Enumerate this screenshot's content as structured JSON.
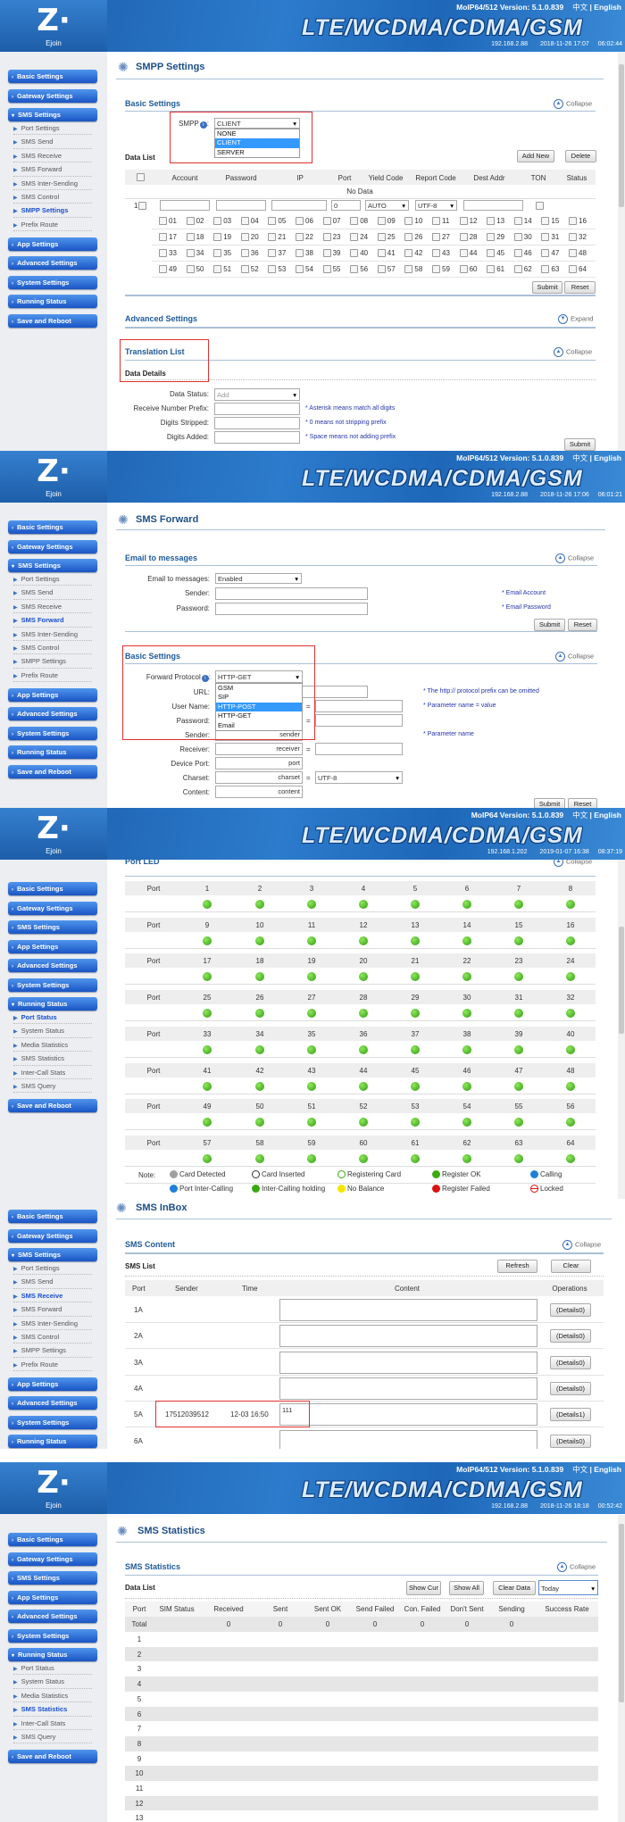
{
  "brand": {
    "logo": "Z·",
    "name": "Ejoin",
    "banner": "LTE/WCDMA/CDMA/GSM",
    "lang_zh": "中文",
    "lang_sep": "|",
    "lang_en": "English"
  },
  "colors": {
    "accent": "#1a55c4",
    "highlight": "#3399ff",
    "red_box": "#e03030",
    "led_ok": "#2f9a10"
  },
  "panels": [
    {
      "header": {
        "version": "MoIP64/512 Version: 5.1.0.839",
        "ip": "192.168.2.88",
        "datetime": "2018-11-26 17:07",
        "uptime": "06:02:44"
      },
      "sidebar": [
        {
          "label": "Basic Settings",
          "group": true
        },
        {
          "label": "Gateway Settings",
          "group": true
        },
        {
          "label": "SMS Settings",
          "group": true,
          "expanded": true,
          "items": [
            {
              "label": "Port Settings"
            },
            {
              "label": "SMS Send"
            },
            {
              "label": "SMS Receive"
            },
            {
              "label": "SMS Forward"
            },
            {
              "label": "SMS Inter-Sending"
            },
            {
              "label": "SMS Control"
            },
            {
              "label": "SMPP Settings",
              "active": true
            },
            {
              "label": "Prefix Route"
            }
          ]
        },
        {
          "label": "App Settings",
          "group": true
        },
        {
          "label": "Advanced Settings",
          "group": true
        },
        {
          "label": "System Settings",
          "group": true
        },
        {
          "label": "Running Status",
          "group": true
        },
        {
          "label": "Save and Reboot",
          "group": true
        }
      ],
      "title": "SMPP Settings",
      "basic": {
        "heading": "Basic Settings",
        "collapse": "Collapse",
        "smpp_label": "SMPP",
        "smpp_value": "CLIENT",
        "smpp_options": [
          "NONE",
          "CLIENT",
          "SERVER"
        ],
        "smpp_selected": "CLIENT"
      },
      "data_list": {
        "label": "Data List",
        "add_new": "Add New",
        "delete": "Delete",
        "columns": [
          "Account",
          "Password",
          "IP",
          "Port",
          "Yield Code",
          "Report Code",
          "Dest Addr",
          "TON",
          "Status"
        ],
        "no_data": "No Data",
        "new_row": {
          "index": "1",
          "port": "0",
          "yield": "AUTO",
          "report": "UTF-8"
        },
        "port_count": 64
      },
      "submit": "Submit",
      "reset": "Reset",
      "advanced": {
        "heading": "Advanced Settings",
        "expand": "Expand"
      },
      "translation": {
        "heading": "Translation List",
        "collapse": "Collapse",
        "details": "Data Details",
        "fields": [
          {
            "label": "Data Status:",
            "value": "Add",
            "type": "select",
            "hint": ""
          },
          {
            "label": "Receive Number Prefix:",
            "value": "",
            "type": "input",
            "hint": "* Asterisk means match all digits"
          },
          {
            "label": "Digits Stripped:",
            "value": "",
            "type": "input",
            "hint": "* 0 means not stripping prefix"
          },
          {
            "label": "Digits Added:",
            "value": "",
            "type": "input",
            "hint": "* Space means not adding prefix"
          }
        ],
        "submit": "Submit"
      }
    },
    {
      "header": {
        "version": "MoIP64/512 Version: 5.1.0.839",
        "ip": "192.168.2.88",
        "datetime": "2018-11-26 17:06",
        "uptime": "06:01:21"
      },
      "sidebar": [
        {
          "label": "Basic Settings",
          "group": true
        },
        {
          "label": "Gateway Settings",
          "group": true
        },
        {
          "label": "SMS Settings",
          "group": true,
          "expanded": true,
          "items": [
            {
              "label": "Port Settings"
            },
            {
              "label": "SMS Send"
            },
            {
              "label": "SMS Receive"
            },
            {
              "label": "SMS Forward",
              "active": true
            },
            {
              "label": "SMS Inter-Sending"
            },
            {
              "label": "SMS Control"
            },
            {
              "label": "SMPP Settings"
            },
            {
              "label": "Prefix Route"
            }
          ]
        },
        {
          "label": "App Settings",
          "group": true
        },
        {
          "label": "Advanced Settings",
          "group": true
        },
        {
          "label": "System Settings",
          "group": true
        },
        {
          "label": "Running Status",
          "group": true
        },
        {
          "label": "Save and Reboot",
          "group": true
        }
      ],
      "title": "SMS Forward",
      "email": {
        "heading": "Email to messages",
        "collapse": "Collapse",
        "mode_label": "Email to messages:",
        "mode_value": "Enabled",
        "sender_label": "Sender:",
        "password_label": "Password:",
        "sender_hint": "* Email Account",
        "password_hint": "* Email Password",
        "submit": "Submit",
        "reset": "Reset"
      },
      "basic": {
        "heading": "Basic Settings",
        "collapse": "Collapse",
        "protocol_label": "Forward Protocol",
        "protocol_value": "HTTP-GET",
        "protocol_options": [
          "GSM",
          "SIP",
          "HTTP-POST",
          "HTTP-GET",
          "Email"
        ],
        "protocol_highlight": "HTTP-POST",
        "url_label": "URL:",
        "url_hint": "* The http:// protocol prefix can be omitted",
        "user_label": "User Name:",
        "user_hint": "* Parameter name = value",
        "password_label": "Password:",
        "sender_label": "Sender:",
        "sender_value": "sender",
        "sender_hint": "* Parameter name",
        "receiver_label": "Receiver:",
        "receiver_value": "receiver",
        "port_label": "Device Port:",
        "port_value": "port",
        "charset_label": "Charset:",
        "charset_value": "charset",
        "charset_select": "UTF-8",
        "content_label": "Content:",
        "content_value": "content",
        "equals": "=",
        "submit": "Submit",
        "reset": "Reset"
      }
    },
    {
      "header": {
        "version": "MoIP64 Version: 5.1.0.839",
        "ip": "192.168.1.202",
        "datetime": "2019-01-07 16:38",
        "uptime": "08:37:19"
      },
      "sidebar": [
        {
          "label": "Basic Settings",
          "group": true
        },
        {
          "label": "Gateway Settings",
          "group": true
        },
        {
          "label": "SMS Settings",
          "group": true
        },
        {
          "label": "App Settings",
          "group": true
        },
        {
          "label": "Advanced Settings",
          "group": true
        },
        {
          "label": "System Settings",
          "group": true
        },
        {
          "label": "Running Status",
          "group": true,
          "expanded": true,
          "items": [
            {
              "label": "Port Status",
              "active": true
            },
            {
              "label": "System Status"
            },
            {
              "label": "Media Statistics"
            },
            {
              "label": "SMS Statistics"
            },
            {
              "label": "Inter-Call Stats"
            },
            {
              "label": "SMS Query"
            }
          ]
        },
        {
          "label": "Save and Reboot",
          "group": true
        }
      ],
      "section": {
        "heading": "Port LED",
        "collapse": "Collapse"
      },
      "port_label": "Port",
      "ports": {
        "count": 64,
        "per_row": 8,
        "status": "Register OK"
      },
      "legend": {
        "note": "Note:",
        "items": [
          {
            "label": "Card Detected",
            "color": "#a0a0a0",
            "style": "fill"
          },
          {
            "label": "Card Inserted",
            "color": "#333333",
            "style": "ring"
          },
          {
            "label": "Registering Card",
            "color": "#3aaa10",
            "style": "ring"
          },
          {
            "label": "Register OK",
            "color": "#3aaa10",
            "style": "fill"
          },
          {
            "label": "Calling",
            "color": "#1f7fd8",
            "style": "fill"
          },
          {
            "label": "Port Inter-Calling",
            "color": "#1f7fd8",
            "style": "bar"
          },
          {
            "label": "Inter-Calling holding",
            "color": "#3aaa10",
            "style": "bar"
          },
          {
            "label": "No Balance",
            "color": "#f5e600",
            "style": "fill"
          },
          {
            "label": "Register Failed",
            "color": "#dd1010",
            "style": "fill"
          },
          {
            "label": "Locked",
            "color": "#dd1010",
            "style": "lock"
          }
        ]
      }
    },
    {
      "header": null,
      "sidebar": [
        {
          "label": "Basic Settings",
          "group": true
        },
        {
          "label": "Gateway Settings",
          "group": true
        },
        {
          "label": "SMS Settings",
          "group": true,
          "expanded": true,
          "items": [
            {
              "label": "Port Settings"
            },
            {
              "label": "SMS Send"
            },
            {
              "label": "SMS Receive",
              "active": true
            },
            {
              "label": "SMS Forward"
            },
            {
              "label": "SMS Inter-Sending"
            },
            {
              "label": "SMS Control"
            },
            {
              "label": "SMPP Settings"
            },
            {
              "label": "Prefix Route"
            }
          ]
        },
        {
          "label": "App Settings",
          "group": true
        },
        {
          "label": "Advanced Settings",
          "group": true
        },
        {
          "label": "System Settings",
          "group": true
        },
        {
          "label": "Running Status",
          "group": true
        }
      ],
      "title": "SMS InBox",
      "section": {
        "heading": "SMS Content",
        "collapse": "Collapse"
      },
      "list": {
        "label": "SMS List",
        "refresh": "Refresh",
        "clear": "Clear",
        "columns": {
          "port": "Port",
          "sender": "Sender",
          "time": "Time",
          "content": "Content",
          "operations": "Operations"
        },
        "rows": [
          {
            "port": "1A",
            "sender": "",
            "time": "",
            "content": "",
            "op": "(Details0)"
          },
          {
            "port": "2A",
            "sender": "",
            "time": "",
            "content": "",
            "op": "(Details0)"
          },
          {
            "port": "3A",
            "sender": "",
            "time": "",
            "content": "",
            "op": "(Details0)"
          },
          {
            "port": "4A",
            "sender": "",
            "time": "",
            "content": "",
            "op": "(Details0)"
          },
          {
            "port": "5A",
            "sender": "17512039512",
            "time": "12-03 16:50",
            "content": "111",
            "op": "(Details1)"
          },
          {
            "port": "6A",
            "sender": "",
            "time": "",
            "content": "",
            "op": "(Details0)"
          }
        ]
      }
    },
    {
      "header": {
        "version": "MoIP64/512 Version: 5.1.0.839",
        "ip": "192.168.2.88",
        "datetime": "2018-11-26 18:18",
        "uptime": "00:52:42"
      },
      "sidebar": [
        {
          "label": "Basic Settings",
          "group": true
        },
        {
          "label": "Gateway Settings",
          "group": true
        },
        {
          "label": "SMS Settings",
          "group": true
        },
        {
          "label": "App Settings",
          "group": true
        },
        {
          "label": "Advanced Settings",
          "group": true
        },
        {
          "label": "System Settings",
          "group": true
        },
        {
          "label": "Running Status",
          "group": true,
          "expanded": true,
          "items": [
            {
              "label": "Port Status"
            },
            {
              "label": "System Status"
            },
            {
              "label": "Media Statistics"
            },
            {
              "label": "SMS Statistics",
              "active": true
            },
            {
              "label": "Inter-Call Stats"
            },
            {
              "label": "SMS Query"
            }
          ]
        },
        {
          "label": "Save and Reboot",
          "group": true
        }
      ],
      "title": "SMS Statistics",
      "section": {
        "heading": "SMS Statistics",
        "collapse": "Collapse"
      },
      "list": {
        "label": "Data List",
        "show_cur": "Show Cur",
        "show_all": "Show All",
        "clear_data": "Clear Data",
        "range": "Today",
        "columns": [
          "Port",
          "SIM Status",
          "Received",
          "Sent",
          "Sent OK",
          "Send Failed",
          "Con. Failed",
          "Don't Sent",
          "Sending",
          "Success Rate"
        ],
        "total": [
          "Total",
          "",
          "0",
          "0",
          "0",
          "0",
          "0",
          "0",
          "0",
          ""
        ],
        "rows": [
          "1",
          "2",
          "3",
          "4",
          "5",
          "6",
          "7",
          "8",
          "9",
          "10",
          "11",
          "12",
          "13"
        ]
      }
    }
  ]
}
